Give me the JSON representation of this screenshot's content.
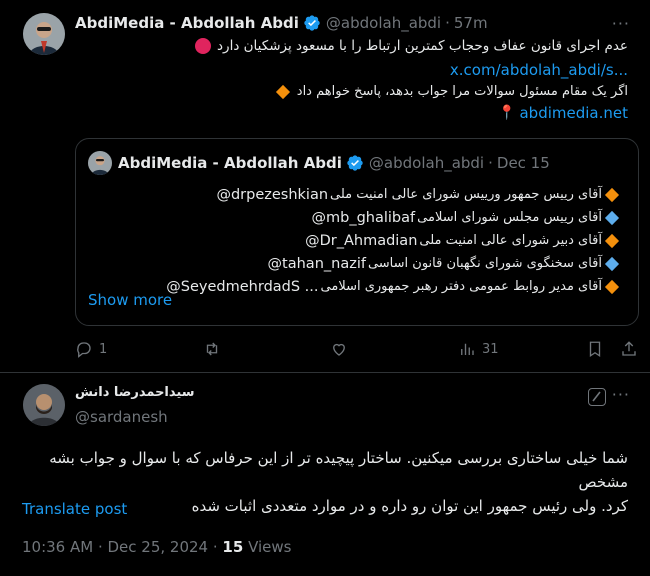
{
  "main_tweet": {
    "author_name": "AbdiMedia - Abdollah Abdi",
    "handle": "@abdolah_abdi",
    "separator": "·",
    "time": "57m",
    "more": "···",
    "line1": "عدم اجرای قانون عفاف وحجاب کمترین ارتباط را با مسعود پزشکیان دارد",
    "line2_link": "x.com/abdolah_abdi/s...",
    "line3": "اگر یک مقام مسئول سوالات مرا جواب بدهد، پاسخ خواهم داد",
    "line4_link": "abdimedia.net",
    "pin": "📍"
  },
  "quote": {
    "author_name": "AbdiMedia - Abdollah Abdi",
    "handle": "@abdolah_abdi",
    "separator": "·",
    "date": "Dec 15",
    "lines": [
      {
        "text": "آقای رییس جمهور ورییس شورای عالی امنیت ملی",
        "mention": "@drpezeshkian",
        "color": "#f4900c"
      },
      {
        "text": "آقای رییس مجلس شورای اسلامی",
        "mention": "@mb_ghalibaf",
        "color": "#5dadec"
      },
      {
        "text": "آقای دبیر شورای عالی امنیت ملی",
        "mention": "@Dr_Ahmadian",
        "color": "#f4900c"
      },
      {
        "text": "آقای سخنگوی شورای نگهبان قانون اساسی",
        "mention": "@tahan_nazif",
        "color": "#5dadec"
      },
      {
        "text": "آقای مدیر روابط عمومی دفتر رهبر جمهوری اسلامی",
        "mention": "@SeyedmehrdadS ...",
        "color": "#f4900c"
      }
    ],
    "show_more": "Show more"
  },
  "actions": {
    "replies": "1",
    "reposts": "",
    "likes": "",
    "views": "31"
  },
  "reply": {
    "author_name": "سیداحمدرضا دانش",
    "handle": "@sardanesh",
    "more": "···",
    "body_line1": "شما خیلی ساختاری بررسی میکنین. ساختار پیچیده تر از این حرفاس که با سوال و جواب بشه مشخص",
    "body_line2": "کرد. ولی رئیس جمهور این توان رو داره و در موارد متعددی اثبات شده",
    "translate": "Translate post",
    "timestamp": "10:36 AM · Dec 25, 2024 ·",
    "views_count": "15",
    "views_label": "Views"
  },
  "colors": {
    "background": "#000000",
    "text": "#e7e9ea",
    "muted": "#71767b",
    "link": "#1d9bf0",
    "border": "#2f3336",
    "red_circle": "#e0245e"
  },
  "icons": [
    "verified-badge-icon",
    "red-circle-icon",
    "orange-diamond-icon",
    "blue-diamond-icon",
    "pin-icon",
    "reply-icon",
    "repost-icon",
    "like-icon",
    "views-icon",
    "bookmark-icon",
    "share-icon",
    "grok-icon",
    "more-icon"
  ]
}
